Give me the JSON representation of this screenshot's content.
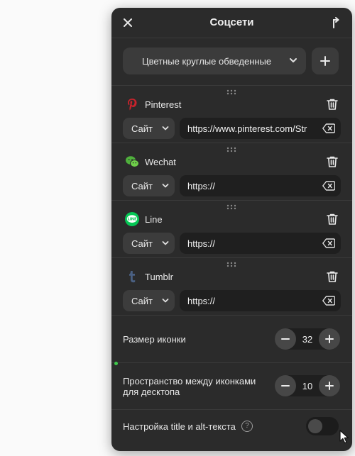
{
  "header": {
    "title": "Соцсети"
  },
  "style_selector": {
    "value": "Цветные круглые обведенные"
  },
  "networks": [
    {
      "name": "Pinterest",
      "type": "Сайт",
      "url": "https://www.pinterest.com/Str",
      "logo": "pinterest-icon",
      "color": "#c8232c"
    },
    {
      "name": "Wechat",
      "type": "Сайт",
      "url": "https://",
      "logo": "wechat-icon",
      "color": "#4fb03c"
    },
    {
      "name": "Line",
      "type": "Сайт",
      "url": "https://",
      "logo": "line-icon",
      "color": "#06c755"
    },
    {
      "name": "Tumblr",
      "type": "Сайт",
      "url": "https://",
      "logo": "tumblr-icon",
      "color": "#36465d"
    }
  ],
  "icon_size": {
    "label": "Размер иконки",
    "value": "32"
  },
  "icon_spacing": {
    "label_line1": "Пространство между иконками",
    "label_line2": "для десктопа",
    "value": "10"
  },
  "alt_text": {
    "label": "Настройка title и alt-текста",
    "help": "?",
    "enabled": false
  }
}
